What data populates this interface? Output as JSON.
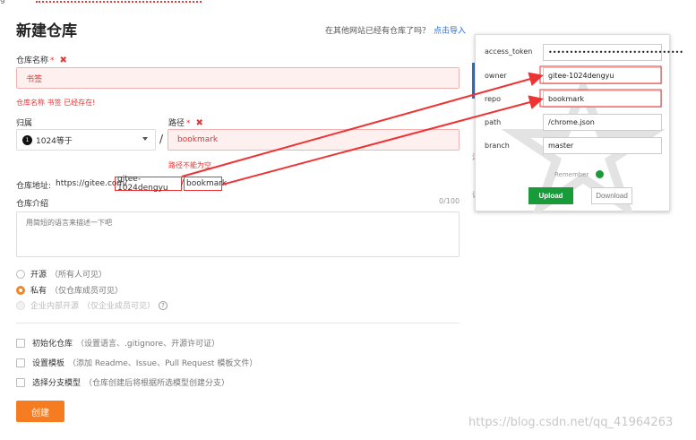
{
  "page": {
    "title": "新建仓库",
    "import_question": "在其他网站已经有仓库了吗？",
    "import_link": "点击导入"
  },
  "repo_name": {
    "label": "仓库名称",
    "required_mark": "*",
    "value": "书签",
    "error": "仓库名称 书签 已经存在!"
  },
  "owner_field": {
    "label": "归属",
    "avatar_text": "1",
    "value": "1024等于",
    "separator": "/"
  },
  "path_field": {
    "label": "路径",
    "required_mark": "*",
    "value": "bookmark",
    "error": "路径不能为空"
  },
  "repo_address": {
    "label": "仓库地址:",
    "prefix": "https://gitee.com/",
    "owner_part": "gitee-1024dengyu",
    "separator": "/",
    "repo_part": "bookmark"
  },
  "description": {
    "label": "仓库介绍",
    "counter": "0/100",
    "placeholder": "用简短的语言来描述一下吧"
  },
  "visibility": [
    {
      "label": "开源",
      "hint": "（所有人可见）",
      "state": "off"
    },
    {
      "label": "私有",
      "hint": "（仅仓库成员可见）",
      "state": "on"
    },
    {
      "label": "企业内部开源",
      "hint": "（仅企业成员可见）",
      "state": "disabled"
    }
  ],
  "options": [
    {
      "label": "初始化仓库",
      "hint": "（设置语言、.gitignore、开源许可证）"
    },
    {
      "label": "设置模板",
      "hint": "（添加 Readme、Issue、Pull Request 模板文件）"
    },
    {
      "label": "选择分支模型",
      "hint": "（仓库创建后将根据所选模型创建分支）"
    }
  ],
  "create_button": "创建",
  "popup": {
    "fields": [
      {
        "label": "access_token",
        "value": "••••••••••••••••••••••••••••••••"
      },
      {
        "label": "owner",
        "value": "gitee-1024dengyu"
      },
      {
        "label": "repo",
        "value": "bookmark"
      },
      {
        "label": "path",
        "value": "/chrome.json"
      },
      {
        "label": "branch",
        "value": "master"
      }
    ],
    "remember_label": "Remember",
    "upload_label": "Upload",
    "download_label": "Download"
  },
  "watermark": "https://blog.csdn.net/qq_41964263",
  "colors": {
    "accent_orange": "#f57c20",
    "error_red": "#e33333",
    "link_blue": "#2a6fd6",
    "upload_green": "#1a9b3a"
  }
}
